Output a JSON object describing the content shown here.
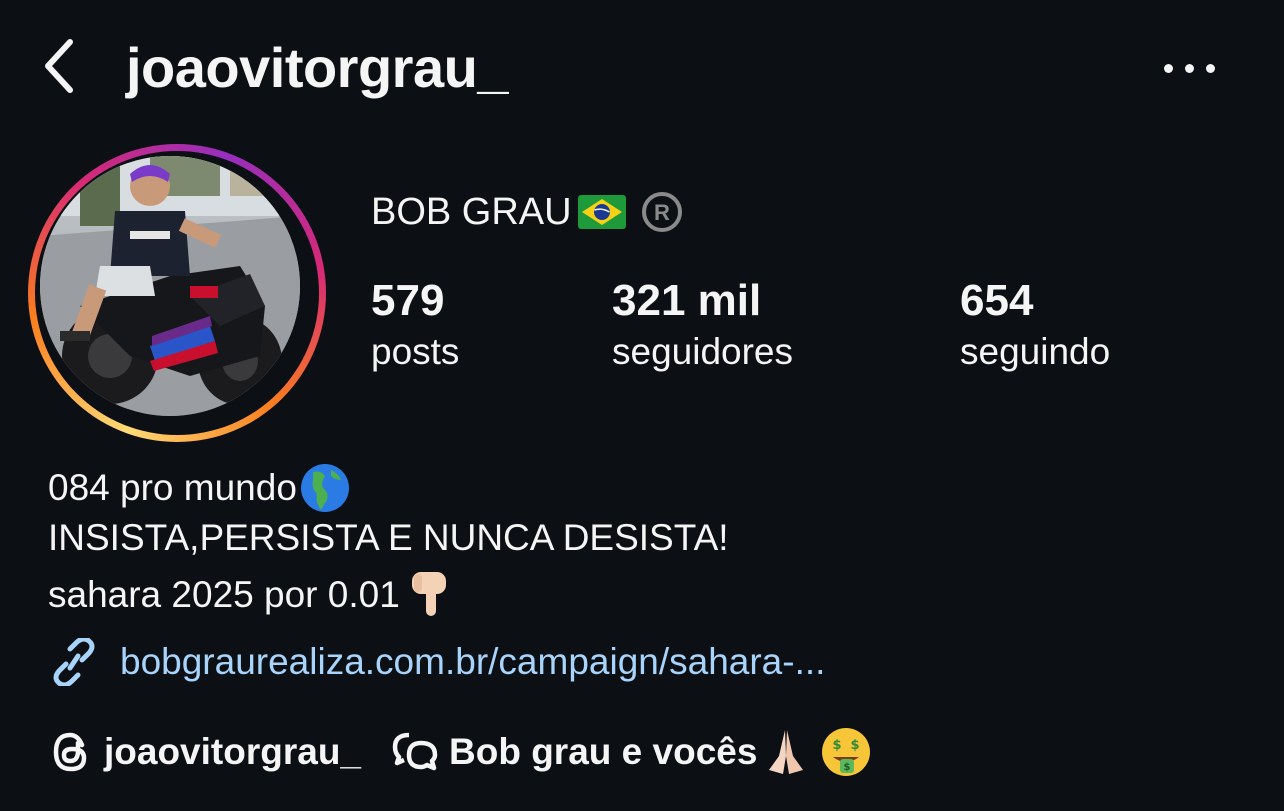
{
  "header": {
    "username": "joaovitorgrau_",
    "back_icon": "chevron-left-icon",
    "more_icon": "more-horizontal-icon"
  },
  "profile": {
    "display_name": "BOB GRAU",
    "flag_icon": "brazil-flag-icon",
    "registered_icon": "registered-mark-icon",
    "avatar_story_ring": true,
    "stats": [
      {
        "value": "579",
        "label": "posts"
      },
      {
        "value": "321 mil",
        "label": "seguidores"
      },
      {
        "value": "654",
        "label": "seguindo"
      }
    ]
  },
  "bio": {
    "line1": "084 pro mundo",
    "line2": "INSISTA,PERSISTA E NUNCA DESISTA!",
    "line3": "sahara 2025 por 0.01"
  },
  "link": {
    "icon": "link-icon",
    "text": "bobgraurealiza.com.br/campaign/sahara-..."
  },
  "threads": {
    "icon": "threads-icon",
    "handle": "joaovitorgrau_"
  },
  "channel": {
    "icon": "broadcast-chat-icon",
    "name": "Bob grau e vocês"
  },
  "colors": {
    "background": "#0c0f14",
    "text": "#f5f5f5",
    "link": "#a8d4fb",
    "ring_start": "#feda75",
    "ring_mid": "#d62976",
    "ring_end": "#962fbf"
  }
}
